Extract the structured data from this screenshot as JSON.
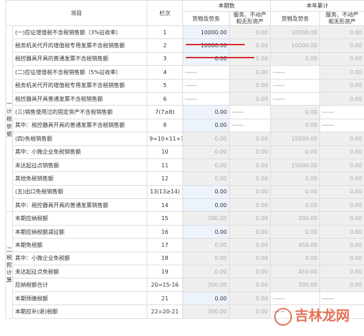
{
  "header": {
    "item": "项目",
    "column_no": "栏次",
    "current_period": "本期数",
    "year_cumulative": "本年累计",
    "goods_labor": "货物及劳务",
    "services_line1": "服务、不动产",
    "services_line2": "和无形资产"
  },
  "sections": {
    "first": "一计税依据",
    "second": "二税款计算"
  },
  "rows": [
    {
      "label": "(一)应征增值税不含税销售额（3%征收率）",
      "code": "1",
      "c1": "10000.00",
      "c2": "0.00",
      "c3": "10000.00",
      "c4": "0.00"
    },
    {
      "label": "税务机关代开的增值税专用发票不含税销售额",
      "code": "2",
      "c1": "10000.00",
      "c2": "0.00",
      "c3": "10000.00",
      "c4": "0.00"
    },
    {
      "label": "税控器具开具的普通发票不含税销售额",
      "code": "3",
      "c1": "0.00",
      "c2": "0.00",
      "c3": "0.00",
      "c4": "0.00"
    },
    {
      "label": "(二)应征增值税不含税销售额（5%征收率）",
      "code": "4",
      "c1": "------",
      "c2": "0.00",
      "c3": "------",
      "c4": "0.00"
    },
    {
      "label": "税务机关代开的增值税专用发票不含税销售额",
      "code": "5",
      "c1": "------",
      "c2": "0.00",
      "c3": "------",
      "c4": "0.00"
    },
    {
      "label": "税控器具开具普通发票不含税销售额",
      "code": "6",
      "c1": "------",
      "c2": "0.00",
      "c3": "------",
      "c4": "0.00"
    },
    {
      "label": "(三)销售使用过的固定资产不含税销售额",
      "code": "7(7≥8)",
      "c1": "0.00",
      "c2": "------",
      "c3": "0.00",
      "c4": "------"
    },
    {
      "label": "其中：税控器具开具的普通发票不含税销售额",
      "code": "8",
      "c1": "0.00",
      "c2": "------",
      "c3": "0.00",
      "c4": "------"
    },
    {
      "label": "(四)免税销售额",
      "code": "9=10+11+1",
      "c1": "0.00",
      "c2": "0.00",
      "c3": "15000.00",
      "c4": "0.00"
    },
    {
      "label": "其中：小微企业免税销售额",
      "code": "10",
      "c1": "0.00",
      "c2": "0.00",
      "c3": "0.00",
      "c4": "0.00"
    },
    {
      "label": "未达起征点销售额",
      "code": "11",
      "c1": "0.00",
      "c2": "0.00",
      "c3": "15000.00",
      "c4": "0.00"
    },
    {
      "label": "其他免税销售额",
      "code": "12",
      "c1": "0.00",
      "c2": "0.00",
      "c3": "0.00",
      "c4": "0.00"
    },
    {
      "label": "(五)出口免税销售额",
      "code": "13(13≥14)",
      "c1": "0.00",
      "c2": "0.00",
      "c3": "0.00",
      "c4": "0.00"
    },
    {
      "label": "其中：税控器具开具的普通发票销售额",
      "code": "14",
      "c1": "0.00",
      "c2": "0.00",
      "c3": "0.00",
      "c4": "0.00"
    },
    {
      "label": "本期应纳税额",
      "code": "15",
      "c1": "300.00",
      "c2": "0.00",
      "c3": "300.00",
      "c4": "0.00"
    },
    {
      "label": "本期应纳税额减征额",
      "code": "16",
      "c1": "0.00",
      "c2": "0.00",
      "c3": "0.00",
      "c4": "0.00"
    },
    {
      "label": "本期免税额",
      "code": "17",
      "c1": "0.00",
      "c2": "0.00",
      "c3": "450.00",
      "c4": "0.00"
    },
    {
      "label": "其中：小微企业免税额",
      "code": "18",
      "c1": "0.00",
      "c2": "0.00",
      "c3": "0.00",
      "c4": "0.00"
    },
    {
      "label": "未达起征点免税额",
      "code": "19",
      "c1": "0.00",
      "c2": "0.00",
      "c3": "450.00",
      "c4": "0.00"
    },
    {
      "label": "应纳税额合计",
      "code": "20=15-16",
      "c1": "300.00",
      "c2": "0.00",
      "c3": "300.00",
      "c4": "0.00"
    },
    {
      "label": "本期预缴税额",
      "code": "21",
      "c1": "0.00",
      "c2": "0.00",
      "c3": "------",
      "c4": "------"
    },
    {
      "label": "本期应补(退)税额",
      "code": "22=20-21",
      "c1": "300.00",
      "c2": "0.00",
      "c3": "------",
      "c4": "------"
    }
  ],
  "watermark": "吉林龙网",
  "colors": {
    "editable_bg": "#edf3fb",
    "readonly_bg": "#efefef",
    "annotation_red": "#d9262c"
  }
}
